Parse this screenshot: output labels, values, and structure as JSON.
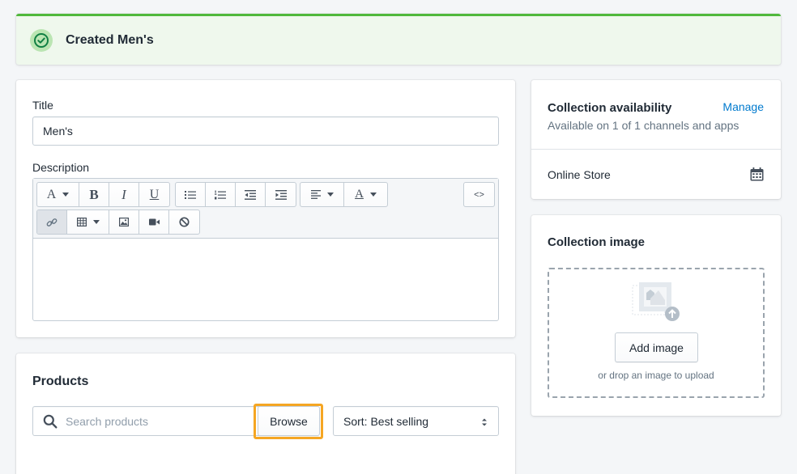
{
  "banner": {
    "text": "Created Men's",
    "icon": "checkmark-circle-icon",
    "color": "#50b83c"
  },
  "form": {
    "title_label": "Title",
    "title_value": "Men's",
    "description_label": "Description",
    "toolbar": {
      "font_glyph": "A",
      "bold_glyph": "B",
      "italic_glyph": "I",
      "underline_glyph": "U",
      "text_color_glyph": "A",
      "html_glyph": "<>",
      "icons": [
        "font-dropdown-icon",
        "bold-icon",
        "italic-icon",
        "underline-icon",
        "bullet-list-icon",
        "numbered-list-icon",
        "outdent-icon",
        "indent-icon",
        "align-dropdown-icon",
        "text-color-dropdown-icon",
        "html-toggle-icon",
        "link-icon",
        "table-dropdown-icon",
        "image-icon",
        "video-icon",
        "clear-format-icon"
      ]
    }
  },
  "products": {
    "heading": "Products",
    "search_placeholder": "Search products",
    "browse_label": "Browse",
    "sort_label": "Sort: Best selling",
    "highlight_color": "#f5a623"
  },
  "availability": {
    "heading": "Collection availability",
    "manage_label": "Manage",
    "subtitle": "Available on 1 of 1 channels and apps",
    "channel": "Online Store"
  },
  "collection_image": {
    "heading": "Collection image",
    "add_label": "Add image",
    "hint": "or drop an image to upload"
  }
}
